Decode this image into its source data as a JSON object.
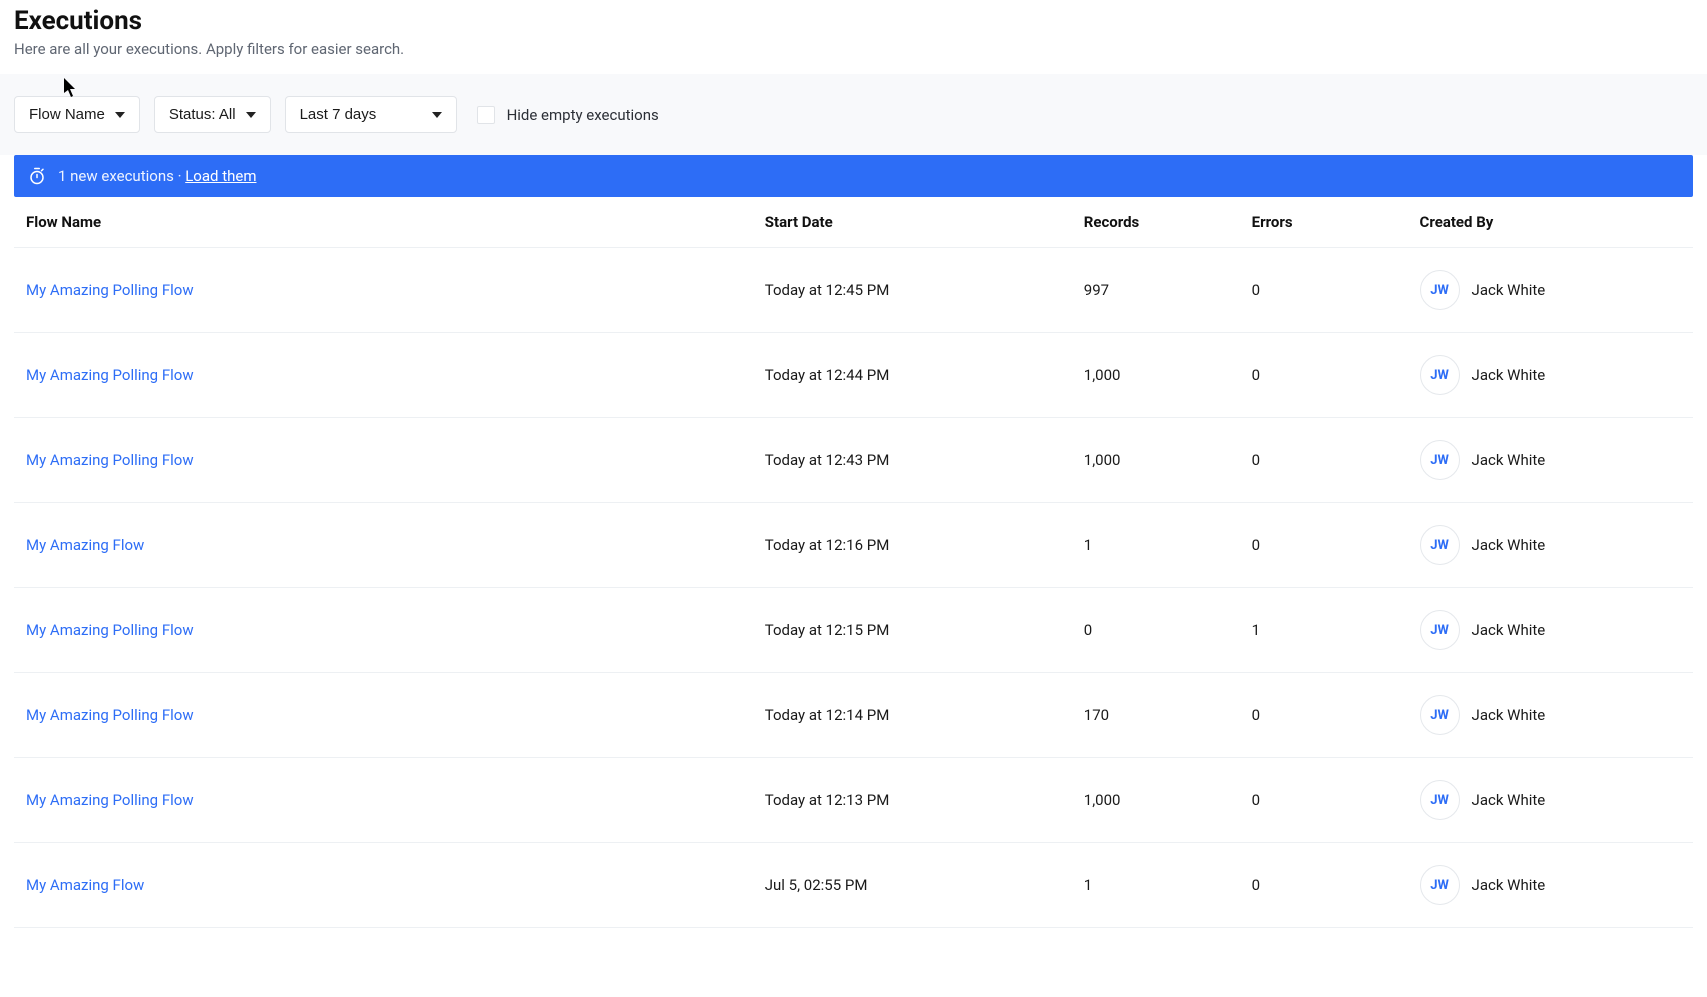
{
  "header": {
    "title": "Executions",
    "subtitle": "Here are all your executions. Apply filters for easier search."
  },
  "filters": {
    "flow_name_label": "Flow Name",
    "status_label": "Status: All",
    "date_label": "Last 7 days",
    "hide_empty_label": "Hide empty executions"
  },
  "banner": {
    "text": "1 new executions",
    "separator": " · ",
    "link_label": "Load them"
  },
  "table": {
    "columns": {
      "flow_name": "Flow Name",
      "start_date": "Start Date",
      "records": "Records",
      "errors": "Errors",
      "created_by": "Created By"
    },
    "rows": [
      {
        "flow": "My Amazing Polling Flow",
        "date": "Today at 12:45 PM",
        "records": "997",
        "errors": "0",
        "initials": "JW",
        "creator": "Jack White"
      },
      {
        "flow": "My Amazing Polling Flow",
        "date": "Today at 12:44 PM",
        "records": "1,000",
        "errors": "0",
        "initials": "JW",
        "creator": "Jack White"
      },
      {
        "flow": "My Amazing Polling Flow",
        "date": "Today at 12:43 PM",
        "records": "1,000",
        "errors": "0",
        "initials": "JW",
        "creator": "Jack White"
      },
      {
        "flow": "My Amazing Flow",
        "date": "Today at 12:16 PM",
        "records": "1",
        "errors": "0",
        "initials": "JW",
        "creator": "Jack White"
      },
      {
        "flow": "My Amazing Polling Flow",
        "date": "Today at 12:15 PM",
        "records": "0",
        "errors": "1",
        "initials": "JW",
        "creator": "Jack White"
      },
      {
        "flow": "My Amazing Polling Flow",
        "date": "Today at 12:14 PM",
        "records": "170",
        "errors": "0",
        "initials": "JW",
        "creator": "Jack White"
      },
      {
        "flow": "My Amazing Polling Flow",
        "date": "Today at 12:13 PM",
        "records": "1,000",
        "errors": "0",
        "initials": "JW",
        "creator": "Jack White"
      },
      {
        "flow": "My Amazing Flow",
        "date": "Jul 5, 02:55 PM",
        "records": "1",
        "errors": "0",
        "initials": "JW",
        "creator": "Jack White"
      }
    ]
  }
}
